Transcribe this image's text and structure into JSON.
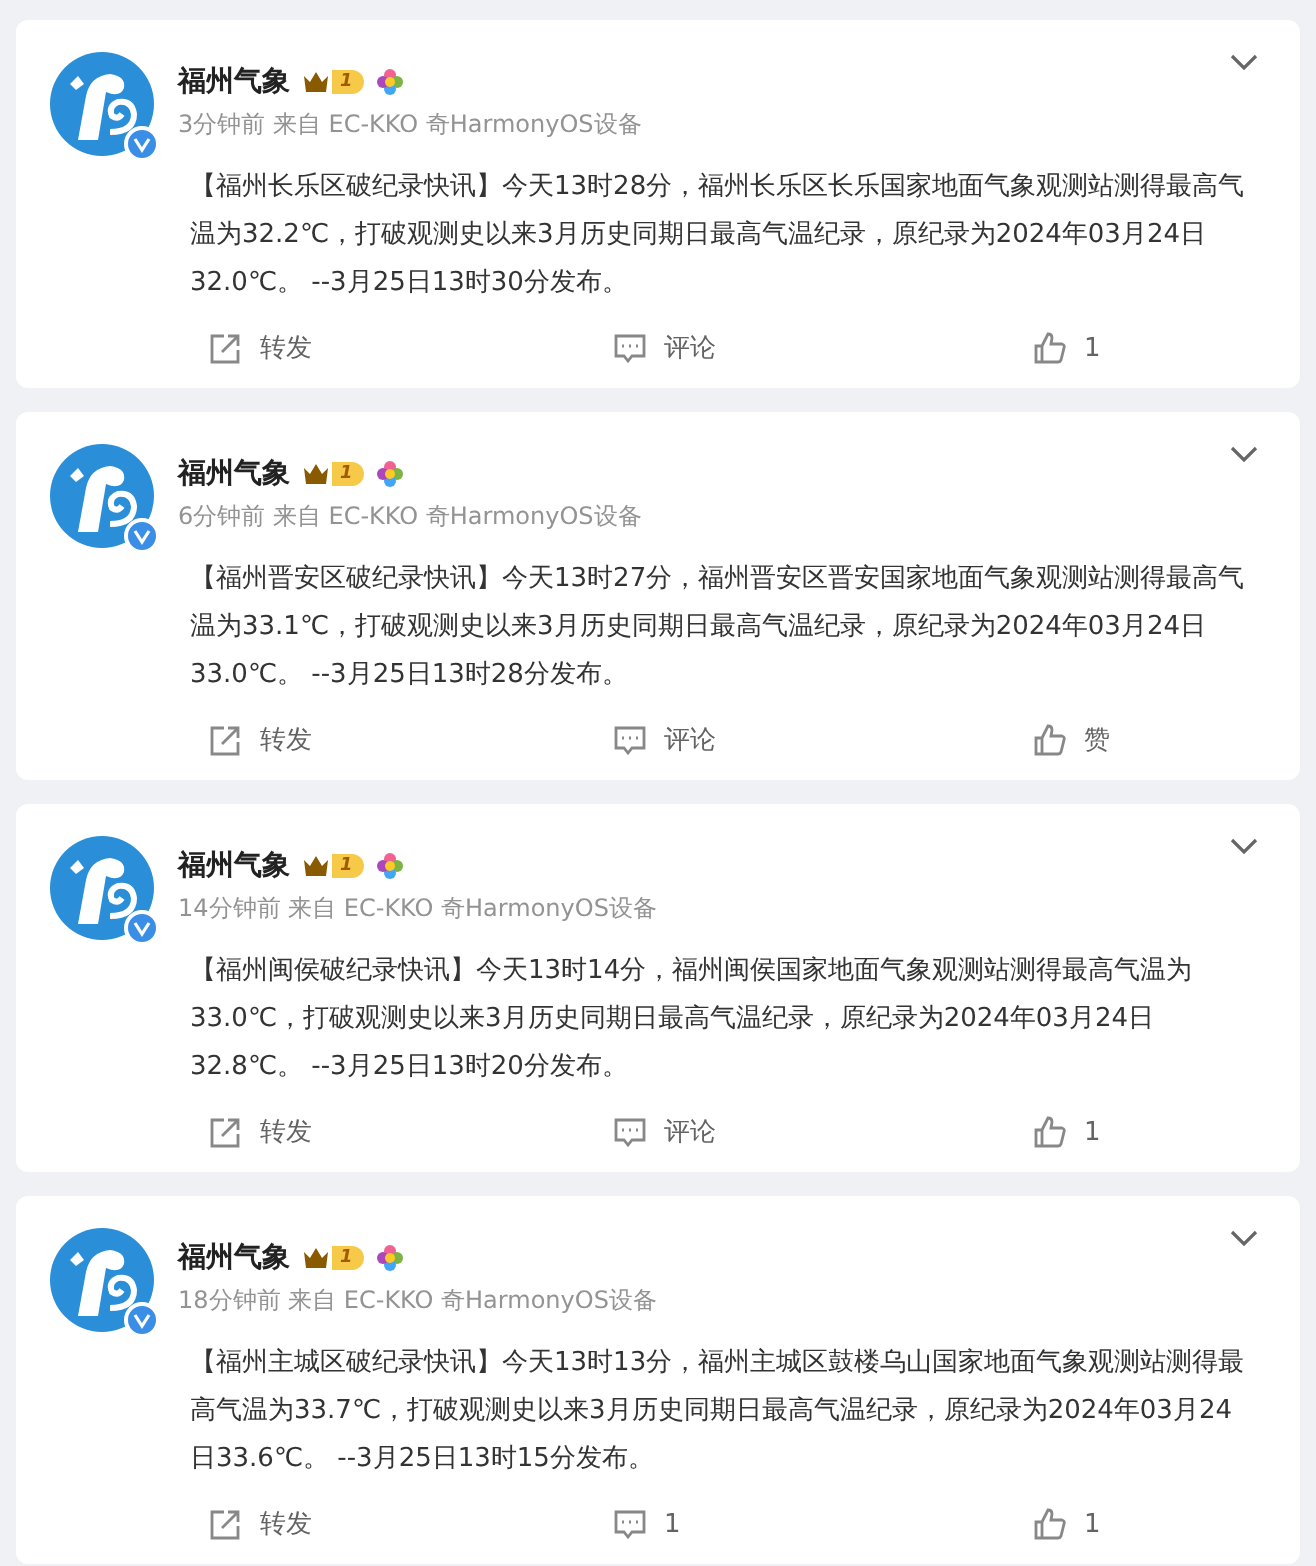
{
  "posts": [
    {
      "author": "福州气象",
      "level_badge": "1",
      "meta": "3分钟前 来自 EC-KKO 奇HarmonyOS设备",
      "text": "【福州长乐区破纪录快讯】今天13时28分，福州长乐区长乐国家地面气象观测站测得最高气温为32.2℃，打破观测史以来3月历史同期日最高气温纪录，原纪录为2024年03月24日32.0℃。 --3月25日13时30分发布。",
      "repost": "转发",
      "comment": "评论",
      "like": "1"
    },
    {
      "author": "福州气象",
      "level_badge": "1",
      "meta": "6分钟前 来自 EC-KKO 奇HarmonyOS设备",
      "text": "【福州晋安区破纪录快讯】今天13时27分，福州晋安区晋安国家地面气象观测站测得最高气温为33.1℃，打破观测史以来3月历史同期日最高气温纪录，原纪录为2024年03月24日33.0℃。 --3月25日13时28分发布。",
      "repost": "转发",
      "comment": "评论",
      "like": "赞"
    },
    {
      "author": "福州气象",
      "level_badge": "1",
      "meta": "14分钟前 来自 EC-KKO 奇HarmonyOS设备",
      "text": "【福州闽侯破纪录快讯】今天13时14分，福州闽侯国家地面气象观测站测得最高气温为33.0℃，打破观测史以来3月历史同期日最高气温纪录，原纪录为2024年03月24日32.8℃。 --3月25日13时20分发布。",
      "repost": "转发",
      "comment": "评论",
      "like": "1"
    },
    {
      "author": "福州气象",
      "level_badge": "1",
      "meta": "18分钟前 来自 EC-KKO 奇HarmonyOS设备",
      "text": "【福州主城区破纪录快讯】今天13时13分，福州主城区鼓楼乌山国家地面气象观测站测得最高气温为33.7℃，打破观测史以来3月历史同期日最高气温纪录，原纪录为2024年03月24日33.6℃。 --3月25日13时15分发布。",
      "repost": "转发",
      "comment": "1",
      "like": "1"
    }
  ]
}
